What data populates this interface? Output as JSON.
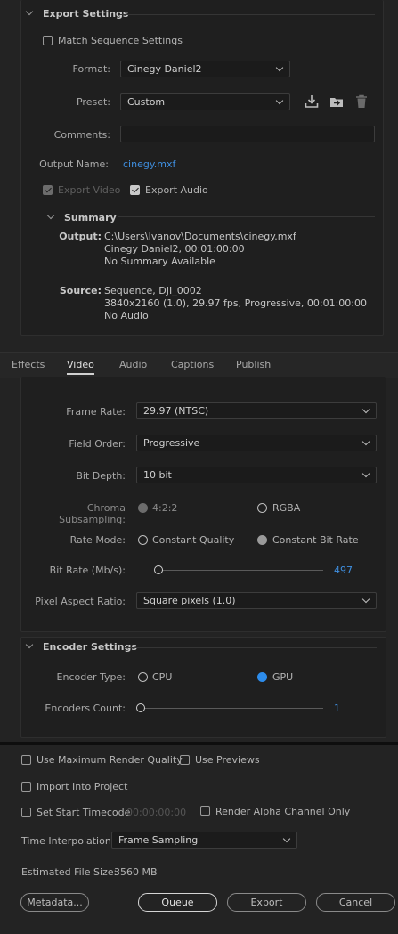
{
  "export_settings": {
    "title": "Export Settings",
    "match_sequence_label": "Match Sequence Settings",
    "format_label": "Format:",
    "format_value": "Cinegy Daniel2",
    "preset_label": "Preset:",
    "preset_value": "Custom",
    "comments_label": "Comments:",
    "comments_value": "",
    "output_name_label": "Output Name:",
    "output_name_value": "cinegy.mxf",
    "export_video_label": "Export Video",
    "export_audio_label": "Export Audio",
    "summary": {
      "title": "Summary",
      "output_label": "Output:",
      "output_lines": [
        "C:\\Users\\Ivanov\\Documents\\cinegy.mxf",
        "Cinegy Daniel2, 00:01:00:00",
        "No Summary Available"
      ],
      "source_label": "Source:",
      "source_lines": [
        "Sequence, DJI_0002",
        "3840x2160 (1.0), 29.97 fps, Progressive, 00:01:00:00",
        "No Audio"
      ]
    }
  },
  "tabs": [
    "Effects",
    "Video",
    "Audio",
    "Captions",
    "Publish"
  ],
  "active_tab": "Video",
  "video": {
    "frame_rate_label": "Frame Rate:",
    "frame_rate_value": "29.97 (NTSC)",
    "field_order_label": "Field Order:",
    "field_order_value": "Progressive",
    "bit_depth_label": "Bit Depth:",
    "bit_depth_value": "10 bit",
    "chroma_label": "Chroma Subsampling:",
    "chroma_opt1": "4:2:2",
    "chroma_opt2": "RGBA",
    "rate_mode_label": "Rate Mode:",
    "rate_mode_opt1": "Constant Quality",
    "rate_mode_opt2": "Constant Bit Rate",
    "bit_rate_label": "Bit Rate (Mb/s):",
    "bit_rate_value": "497",
    "par_label": "Pixel Aspect Ratio:",
    "par_value": "Square pixels (1.0)"
  },
  "encoder": {
    "title": "Encoder Settings",
    "type_label": "Encoder Type:",
    "type_opt1": "CPU",
    "type_opt2": "GPU",
    "count_label": "Encoders Count:",
    "count_value": "1"
  },
  "bottom": {
    "max_render_label": "Use Maximum Render Quality",
    "use_previews_label": "Use Previews",
    "import_label": "Import Into Project",
    "start_tc_label": "Set Start Timecode",
    "start_tc_value": "00:00:00:00",
    "render_alpha_label": "Render Alpha Channel Only",
    "time_interp_label": "Time Interpolation:",
    "time_interp_value": "Frame Sampling",
    "file_size_label": "Estimated File Size:",
    "file_size_value": "3560 MB",
    "metadata_btn": "Metadata...",
    "queue_btn": "Queue",
    "export_btn": "Export",
    "cancel_btn": "Cancel"
  },
  "colors": {
    "accent": "#2d8ceb",
    "link": "#3f8fe0",
    "background": "#232323"
  }
}
